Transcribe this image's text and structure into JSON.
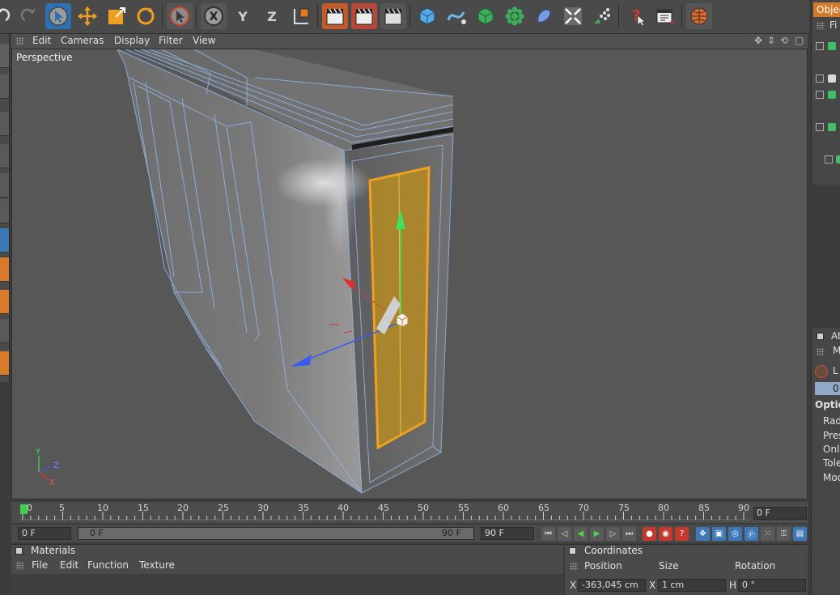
{
  "colors": {
    "accent": "#d2792a",
    "selection_blue": "#2f6fb0",
    "wireframe": "#8fb8ea",
    "highlight": "#f0a020"
  },
  "toolbar": {
    "axis_labels": [
      "X",
      "Y",
      "Z"
    ],
    "icons": [
      "undo-icon",
      "redo-icon",
      "live-selection-icon",
      "move-icon",
      "scale-icon",
      "rotate-icon",
      "last-tool-icon",
      "x-axis-lock-icon",
      "y-axis-lock-icon",
      "z-axis-lock-icon",
      "coordinate-system-icon",
      "render-view-icon",
      "render-picture-icon",
      "render-settings-icon",
      "cube-icon",
      "spline-icon",
      "subdivision-icon",
      "array-icon",
      "deformer-icon",
      "scene-icon",
      "particles-icon",
      "help-icon",
      "layout-icon",
      "browser-icon"
    ]
  },
  "viewport": {
    "menu": [
      "Edit",
      "Cameras",
      "Display",
      "Filter",
      "View"
    ],
    "label": "Perspective",
    "axis_gizmo": {
      "x": "X",
      "y": "Y",
      "z": "Z"
    }
  },
  "timeline": {
    "ticks": [
      "0",
      "5",
      "10",
      "15",
      "20",
      "25",
      "30",
      "35",
      "40",
      "45",
      "50",
      "55",
      "60",
      "65",
      "70",
      "75",
      "80",
      "85",
      "90"
    ],
    "current_frame": "0 F"
  },
  "transport": {
    "start_frame": "0 F",
    "range_start": "0 F",
    "range_end": "90 F",
    "end_frame": "90 F"
  },
  "materials": {
    "title": "Materials",
    "menu": [
      "File",
      "Edit",
      "Function",
      "Texture"
    ]
  },
  "coordinates": {
    "title": "Coordinates",
    "columns": [
      "Position",
      "Size",
      "Rotation"
    ],
    "row": {
      "pos_axis": "X",
      "pos_value": "-363,045 cm",
      "size_axis": "X",
      "size_value": "1 cm",
      "rot_axis": "H",
      "rot_value": "0 °"
    }
  },
  "object_manager": {
    "tab": "Objects",
    "menu_first": "Fi"
  },
  "attribute_manager": {
    "tab": "At",
    "mode": "M",
    "selected": "0",
    "item_label": "L",
    "section": "Optio",
    "fields": [
      "Rad",
      "Pres",
      "Only",
      "Tole",
      "Mod"
    ]
  }
}
